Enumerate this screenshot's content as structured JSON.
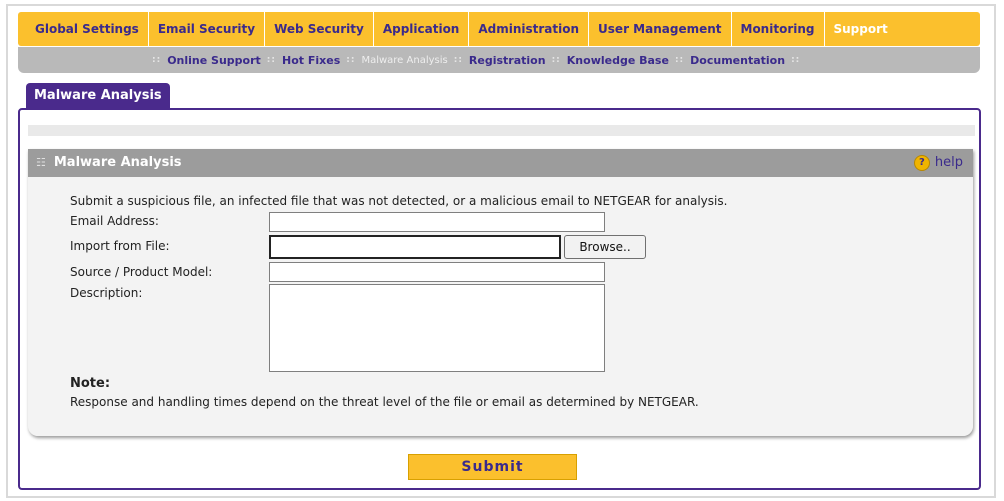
{
  "topnav": {
    "items": [
      {
        "label": "Global Settings"
      },
      {
        "label": "Email Security"
      },
      {
        "label": "Web Security"
      },
      {
        "label": "Application"
      },
      {
        "label": "Administration"
      },
      {
        "label": "User Management"
      },
      {
        "label": "Monitoring"
      },
      {
        "label": "Support"
      }
    ],
    "active": "Support",
    "color": "#fbc02d"
  },
  "subnav": {
    "items": [
      {
        "label": "Online Support"
      },
      {
        "label": "Hot Fixes"
      },
      {
        "label": "Malware Analysis"
      },
      {
        "label": "Registration"
      },
      {
        "label": "Knowledge Base"
      },
      {
        "label": "Documentation"
      }
    ],
    "active": "Malware Analysis"
  },
  "page_tab": {
    "label": "Malware Analysis"
  },
  "section": {
    "title": "Malware Analysis",
    "help_label": "help",
    "help_icon": "question-circle-icon",
    "intro": "Submit a suspicious file, an infected file that was not detected, or a malicious email to NETGEAR for analysis.",
    "fields": {
      "email_label": "Email Address:",
      "email_value": "",
      "import_label": "Import from File:",
      "import_value": "",
      "browse_label": "Browse..",
      "source_label": "Source / Product Model:",
      "source_value": "",
      "description_label": "Description:",
      "description_value": ""
    },
    "note_title": "Note:",
    "note_text": "Response and handling times depend on the threat level of the file or email as determined by NETGEAR."
  },
  "submit_label": "Submit",
  "colors": {
    "accent": "#4a2a8c",
    "nav": "#fbc02d",
    "panel_header": "#9c9c9c"
  }
}
